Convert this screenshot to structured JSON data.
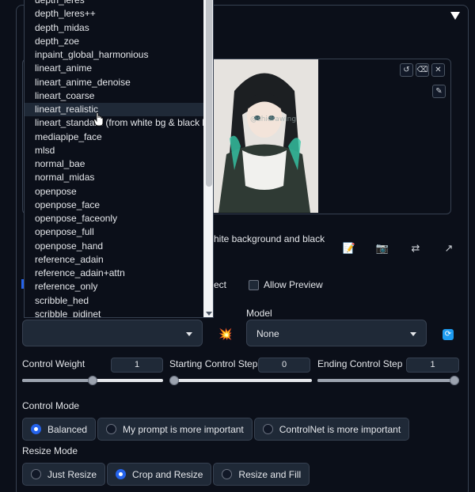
{
  "dropdown": {
    "items": [
      "depth_leres",
      "depth_leres++",
      "depth_midas",
      "depth_zoe",
      "inpaint_global_harmonious",
      "lineart_anime",
      "lineart_anime_denoise",
      "lineart_coarse",
      "lineart_realistic",
      "lineart_standard (from white bg & black line)",
      "mediapipe_face",
      "mlsd",
      "normal_bae",
      "normal_midas",
      "openpose",
      "openpose_face",
      "openpose_faceonly",
      "openpose_full",
      "openpose_hand",
      "reference_adain",
      "reference_adain+attn",
      "reference_only",
      "scribble_hed",
      "scribble_pidinet"
    ],
    "hovered_item": "lineart_realistic"
  },
  "image_panel": {
    "watermark": "@shidrawing",
    "tools": [
      "undo-icon",
      "eraser-icon",
      "close-icon"
    ],
    "brush_tool": "brush-icon"
  },
  "description_fragment": "hite background and black",
  "checkbox_fragment": "ect",
  "allow_preview": {
    "label": "Allow Preview",
    "checked": false
  },
  "action_icons": [
    "edit-icon",
    "camera-icon",
    "swap-icon",
    "send-icon"
  ],
  "preprocessor": {
    "value": ""
  },
  "model": {
    "label": "Model",
    "value": "None"
  },
  "control_weight": {
    "label": "Control Weight",
    "value": "1",
    "fraction": 0.5
  },
  "starting_step": {
    "label": "Starting Control Step",
    "value": "0",
    "fraction": 0.0
  },
  "ending_step": {
    "label": "Ending Control Step",
    "value": "1",
    "fraction": 1.0
  },
  "control_mode": {
    "label": "Control Mode",
    "options": [
      "Balanced",
      "My prompt is more important",
      "ControlNet is more important"
    ],
    "selected": "Balanced"
  },
  "resize_mode": {
    "label": "Resize Mode",
    "options": [
      "Just Resize",
      "Crop and Resize",
      "Resize and Fill"
    ],
    "selected": "Crop and Resize"
  },
  "colors": {
    "accent": "#2563eb",
    "refresh": "#1d9bf0",
    "explode": "#ef4444"
  }
}
